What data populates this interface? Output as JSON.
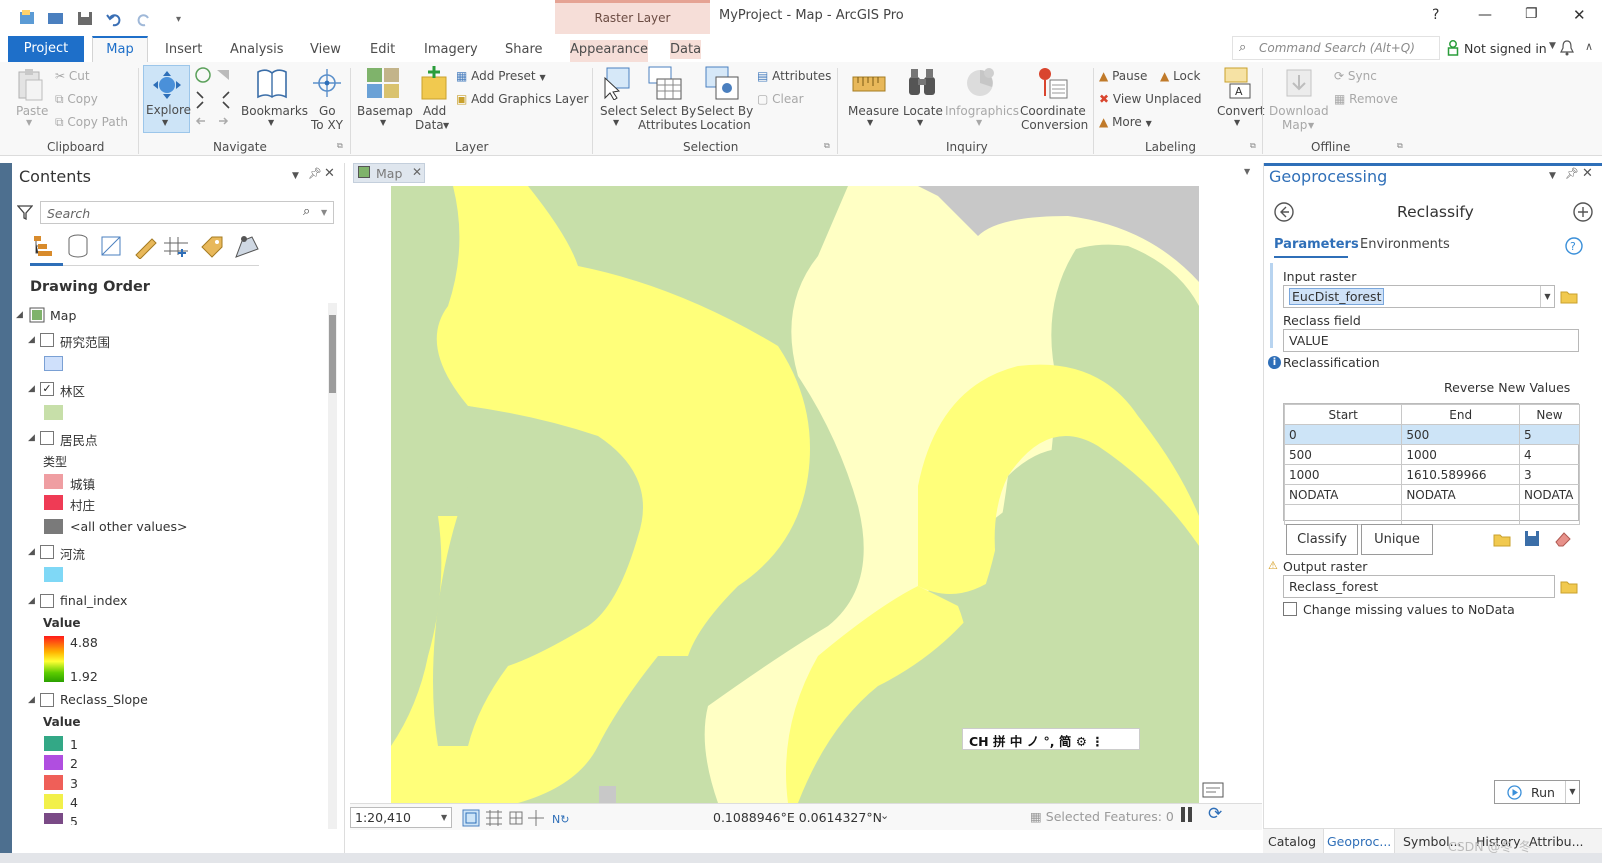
{
  "titlebar": {
    "context_tab": "Raster Layer",
    "title": "MyProject - Map - ArcGIS Pro",
    "help": "?",
    "minimize": "—",
    "restore": "❐",
    "close": "✕"
  },
  "tabs": {
    "project": "Project",
    "map": "Map",
    "insert": "Insert",
    "analysis": "Analysis",
    "view": "View",
    "edit": "Edit",
    "imagery": "Imagery",
    "share": "Share",
    "appearance": "Appearance",
    "data": "Data"
  },
  "search": {
    "placeholder": "Command Search (Alt+Q)"
  },
  "user": {
    "signin": "Not signed in"
  },
  "ribbon": {
    "clipboard": {
      "paste": "Paste",
      "cut": "Cut",
      "copy": "Copy",
      "copy_path": "Copy Path",
      "label": "Clipboard"
    },
    "navigate": {
      "explore": "Explore",
      "bookmarks": "Bookmarks",
      "goto_1": "Go",
      "goto_2": "To XY",
      "label": "Navigate"
    },
    "layer": {
      "basemap": "Basemap",
      "add_data_1": "Add",
      "add_data_2": "Data",
      "add_preset": "Add Preset",
      "add_graphics": "Add Graphics Layer",
      "label": "Layer"
    },
    "selection": {
      "select": "Select",
      "by_attr_1": "Select By",
      "by_attr_2": "Attributes",
      "by_loc_1": "Select By",
      "by_loc_2": "Location",
      "attributes": "Attributes",
      "clear": "Clear",
      "label": "Selection"
    },
    "inquiry": {
      "measure": "Measure",
      "locate": "Locate",
      "infographics": "Infographics",
      "coord_1": "Coordinate",
      "coord_2": "Conversion",
      "label": "Inquiry"
    },
    "labeling": {
      "pause": "Pause",
      "lock": "Lock",
      "view_unplaced": "View Unplaced",
      "more": "More",
      "convert": "Convert",
      "label": "Labeling"
    },
    "offline": {
      "download_1": "Download",
      "download_2": "Map",
      "sync": "Sync",
      "remove": "Remove",
      "label": "Offline"
    }
  },
  "contents": {
    "title": "Contents",
    "search_placeholder": "Search",
    "drawing_order": "Drawing Order",
    "map": "Map",
    "layers": {
      "l1": "研究范围",
      "l2": "林区",
      "l3": "居民点",
      "l3_field": "类型",
      "l3_c1": "城镇",
      "l3_c2": "村庄",
      "l3_c3": "<all other values>",
      "l4": "河流",
      "l5": "final_index",
      "l5_field": "Value",
      "l5_high": "4.88",
      "l5_low": "1.92",
      "l6": "Reclass_Slope",
      "l6_field": "Value",
      "l6_v1": "1",
      "l6_v2": "2",
      "l6_v3": "3",
      "l6_v4": "4",
      "l6_v5": "5"
    }
  },
  "map": {
    "tab": "Map",
    "scale": "1:20,410",
    "coords": "0.1088946°E 0.0614327°N",
    "selected": "Selected Features: 0",
    "ime": "CH 拼 中 ノ °, 简 ⚙ ⋮"
  },
  "geoprocessing": {
    "title": "Geoprocessing",
    "tool": "Reclassify",
    "tab_params": "Parameters",
    "tab_env": "Environments",
    "input_label": "Input raster",
    "input_value": "EucDist_forest",
    "field_label": "Reclass field",
    "field_value": "VALUE",
    "reclass_label": "Reclassification",
    "reverse": "Reverse New Values",
    "headers": [
      "Start",
      "End",
      "New"
    ],
    "rows": [
      [
        "0",
        "500",
        "5"
      ],
      [
        "500",
        "1000",
        "4"
      ],
      [
        "1000",
        "1610.589966",
        "3"
      ],
      [
        "NODATA",
        "NODATA",
        "NODATA"
      ],
      [
        "",
        "",
        ""
      ]
    ],
    "classify": "Classify",
    "unique": "Unique",
    "output_label": "Output raster",
    "output_value": "Reclass_forest",
    "missing": "Change missing values to NoData",
    "run": "Run"
  },
  "bottom_tabs": {
    "catalog": "Catalog",
    "geoproc": "Geoproc...",
    "symbol": "Symbol...",
    "history": "History",
    "attrib": "Attribu..."
  },
  "watermark": "CSDN @冬_冬_"
}
